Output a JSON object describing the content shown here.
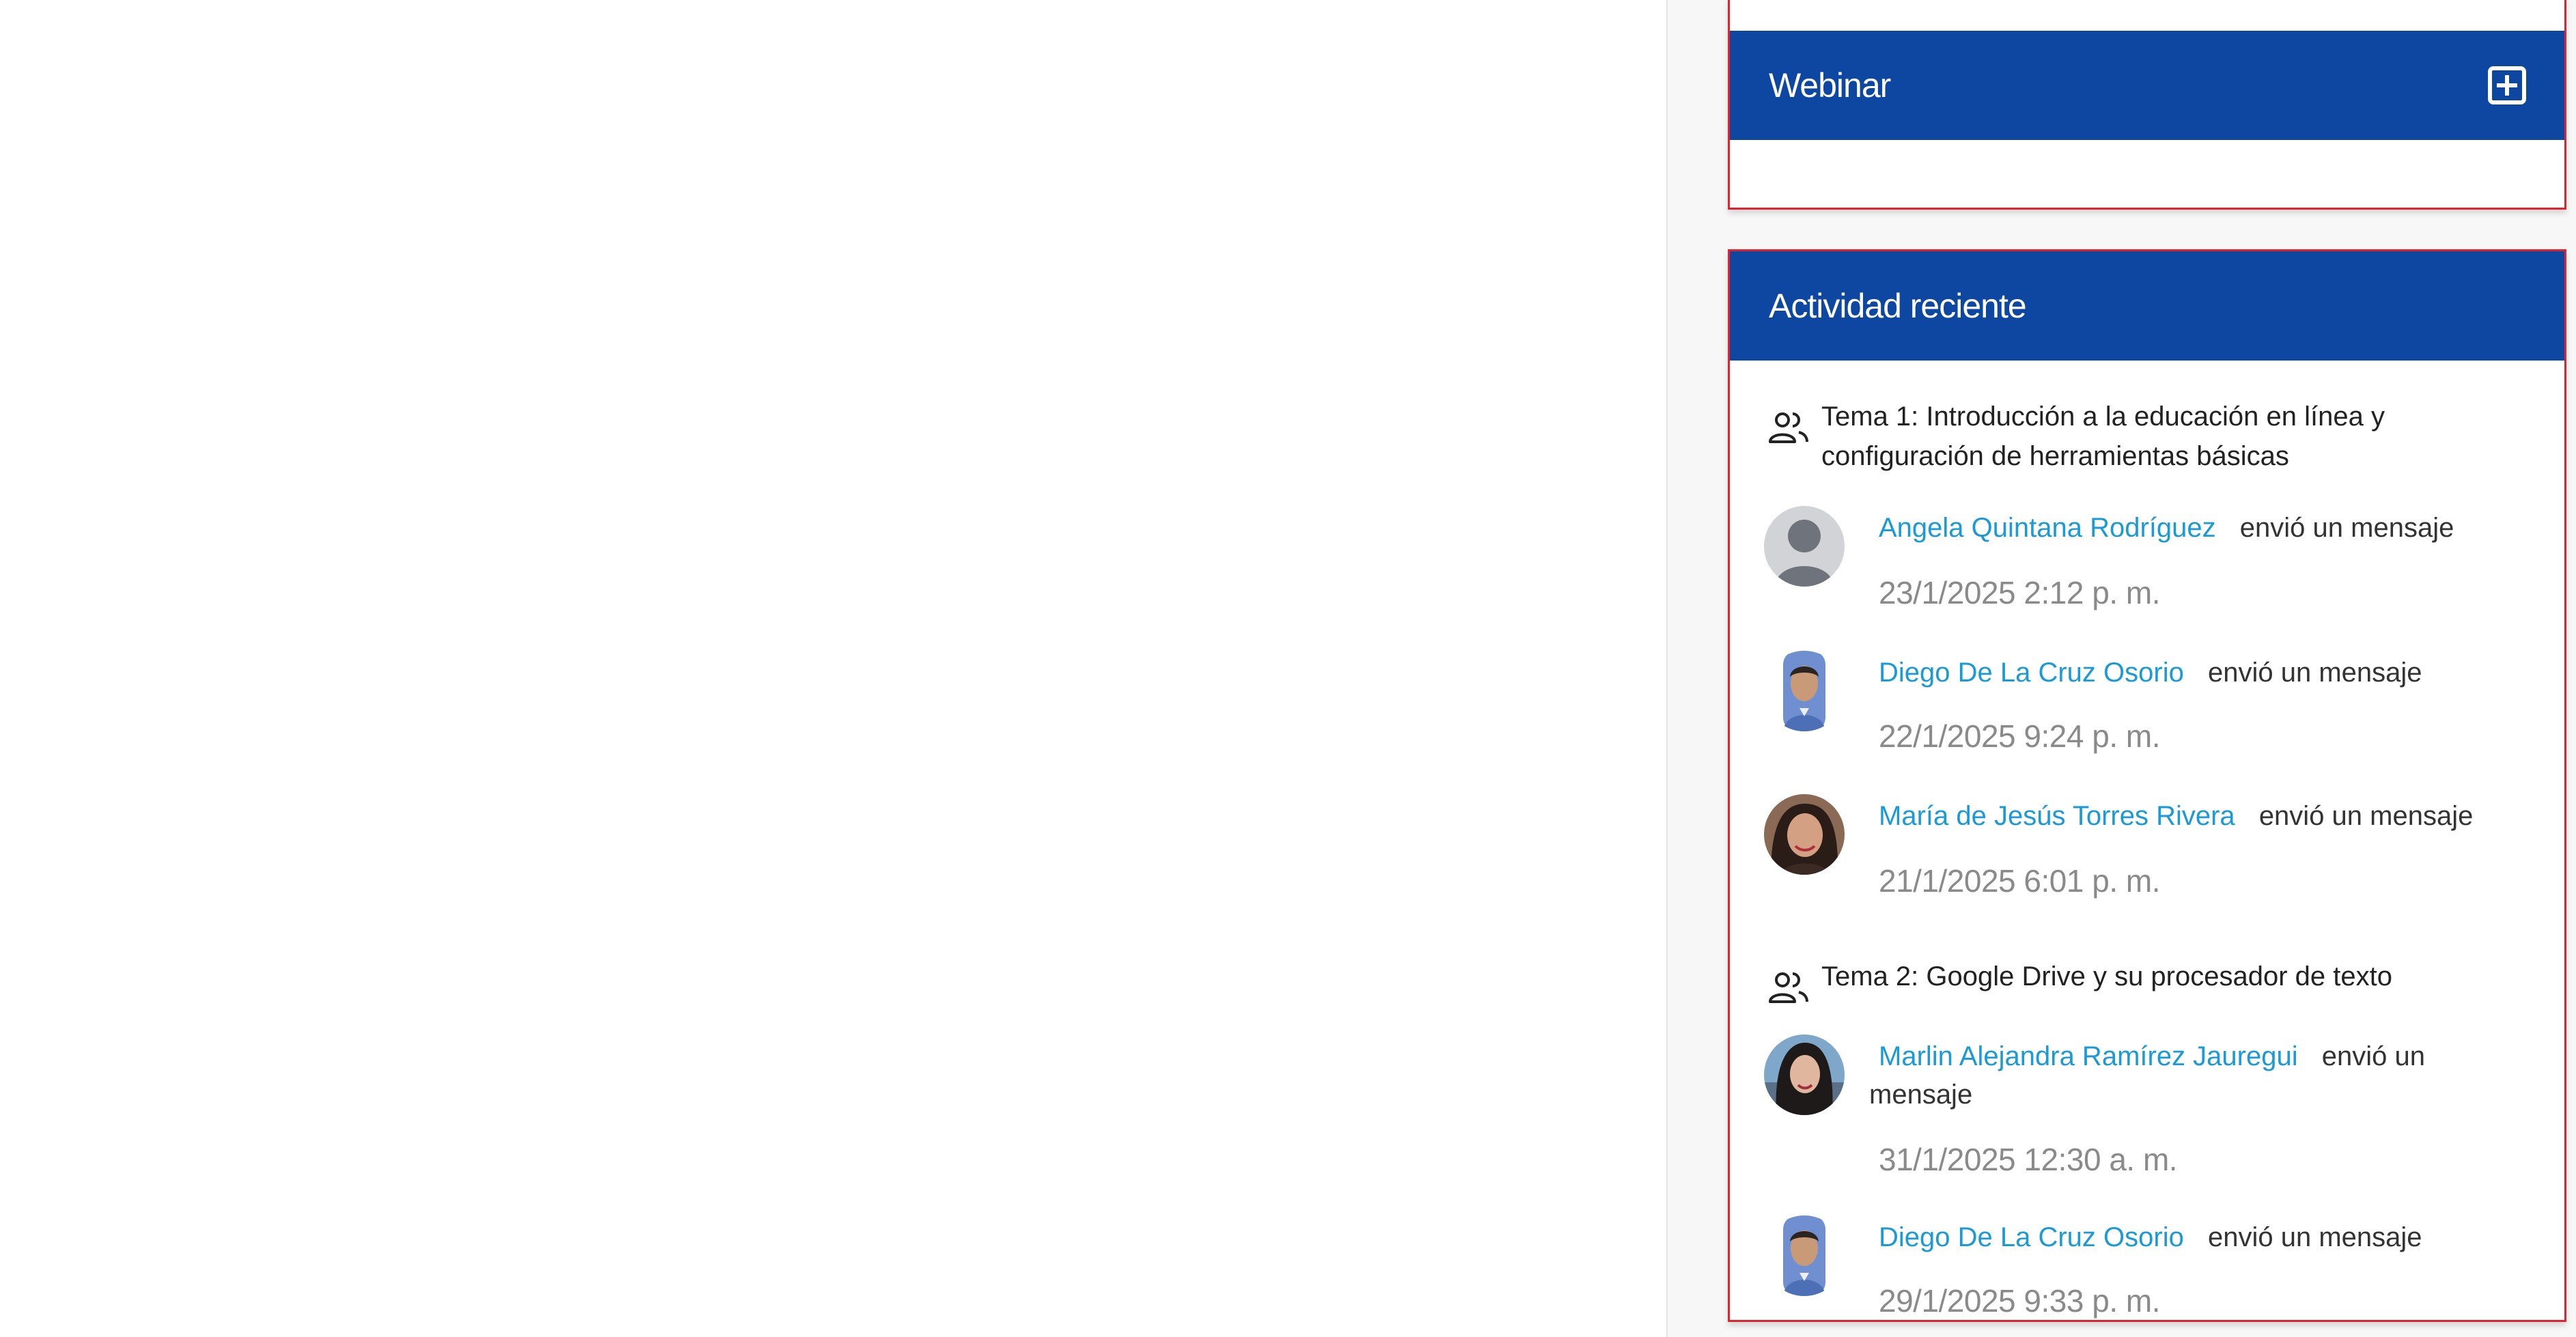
{
  "webinar": {
    "title": "Webinar",
    "add_icon": "plus-square-icon"
  },
  "recent_activity": {
    "title": "Actividad reciente",
    "courses": [
      {
        "icon": "users-icon",
        "title": "Tema 1: Introducción a la educación en línea y configuración de herramientas básicas",
        "items": [
          {
            "user": "Angela Quintana Rodríguez",
            "action": "envió un mensaje",
            "time": "23/1/2025 2:12 p. m.",
            "avatar": "default-user-avatar"
          },
          {
            "user": "Diego De La Cruz Osorio",
            "action": "envió un mensaje",
            "time": "22/1/2025 9:24 p. m.",
            "avatar": "user-photo-avatar"
          },
          {
            "user": "María de Jesús Torres Rivera",
            "action": "envió un mensaje",
            "time": "21/1/2025 6:01 p. m.",
            "avatar": "user-photo-avatar"
          }
        ]
      },
      {
        "icon": "users-icon",
        "title": "Tema 2: Google Drive y su procesador de texto",
        "items": [
          {
            "user": "Marlin Alejandra Ramírez Jauregui",
            "action": "envió un mensaje",
            "time": "31/1/2025 12:30 a. m.",
            "avatar": "user-photo-avatar"
          },
          {
            "user": "Diego De La Cruz Osorio",
            "action": "envió un mensaje",
            "time": "29/1/2025 9:33 p. m.",
            "avatar": "user-photo-avatar"
          }
        ]
      }
    ]
  },
  "colors": {
    "header_bg": "#0d47a1",
    "link": "#1a9ad6",
    "highlight_border": "#e0242e",
    "timestamp": "#8a8a8a"
  }
}
